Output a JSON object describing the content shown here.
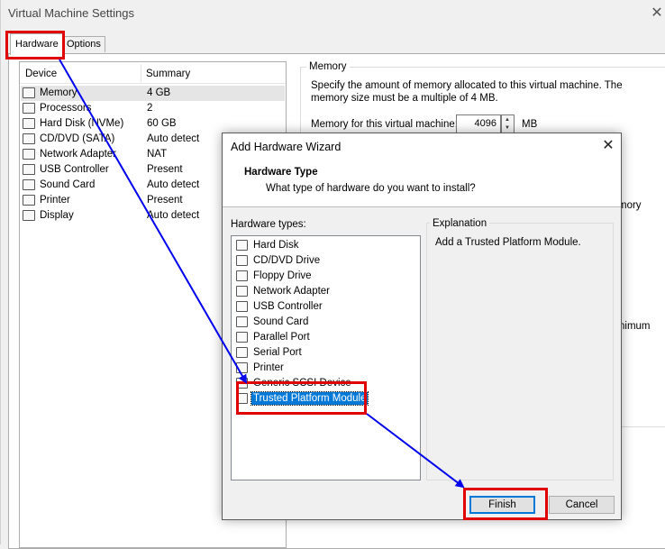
{
  "vm_window": {
    "title": "Virtual Machine Settings",
    "close": "✕",
    "tabs": [
      {
        "label": "Hardware",
        "active": true
      },
      {
        "label": "Options",
        "active": false
      }
    ],
    "device_list": {
      "columns": [
        "Device",
        "Summary"
      ],
      "rows": [
        {
          "name": "Memory",
          "summary": "4 GB",
          "selected": true
        },
        {
          "name": "Processors",
          "summary": "2",
          "selected": false
        },
        {
          "name": "Hard Disk (NVMe)",
          "summary": "60 GB",
          "selected": false
        },
        {
          "name": "CD/DVD (SATA)",
          "summary": "Auto detect",
          "selected": false
        },
        {
          "name": "Network Adapter",
          "summary": "NAT",
          "selected": false
        },
        {
          "name": "USB Controller",
          "summary": "Present",
          "selected": false
        },
        {
          "name": "Sound Card",
          "summary": "Auto detect",
          "selected": false
        },
        {
          "name": "Printer",
          "summary": "Present",
          "selected": false
        },
        {
          "name": "Display",
          "summary": "Auto detect",
          "selected": false
        }
      ]
    },
    "memory": {
      "legend": "Memory",
      "description": "Specify the amount of memory allocated to this virtual machine. The memory size must be a multiple of 4 MB.",
      "field_label": "Memory for this virtual machine:",
      "value": "4096",
      "unit": "MB",
      "partial_text_1": "mory",
      "partial_text_2": "nimum"
    }
  },
  "wizard": {
    "title": "Add Hardware Wizard",
    "close": "✕",
    "header_title": "Hardware Type",
    "header_subtitle": "What type of hardware do you want to install?",
    "list_label": "Hardware types:",
    "hardware_types": [
      {
        "label": "Hard Disk",
        "selected": false
      },
      {
        "label": "CD/DVD Drive",
        "selected": false
      },
      {
        "label": "Floppy Drive",
        "selected": false
      },
      {
        "label": "Network Adapter",
        "selected": false
      },
      {
        "label": "USB Controller",
        "selected": false
      },
      {
        "label": "Sound Card",
        "selected": false
      },
      {
        "label": "Parallel Port",
        "selected": false
      },
      {
        "label": "Serial Port",
        "selected": false
      },
      {
        "label": "Printer",
        "selected": false
      },
      {
        "label": "Generic SCSI Device",
        "selected": false
      },
      {
        "label": "Trusted Platform Module",
        "selected": true
      }
    ],
    "explanation_legend": "Explanation",
    "explanation_text": "Add a Trusted Platform Module.",
    "finish_label": "Finish",
    "cancel_label": "Cancel"
  },
  "annotations": {
    "highlight_color": "#e00000",
    "arrow_color": "#0000ee"
  }
}
